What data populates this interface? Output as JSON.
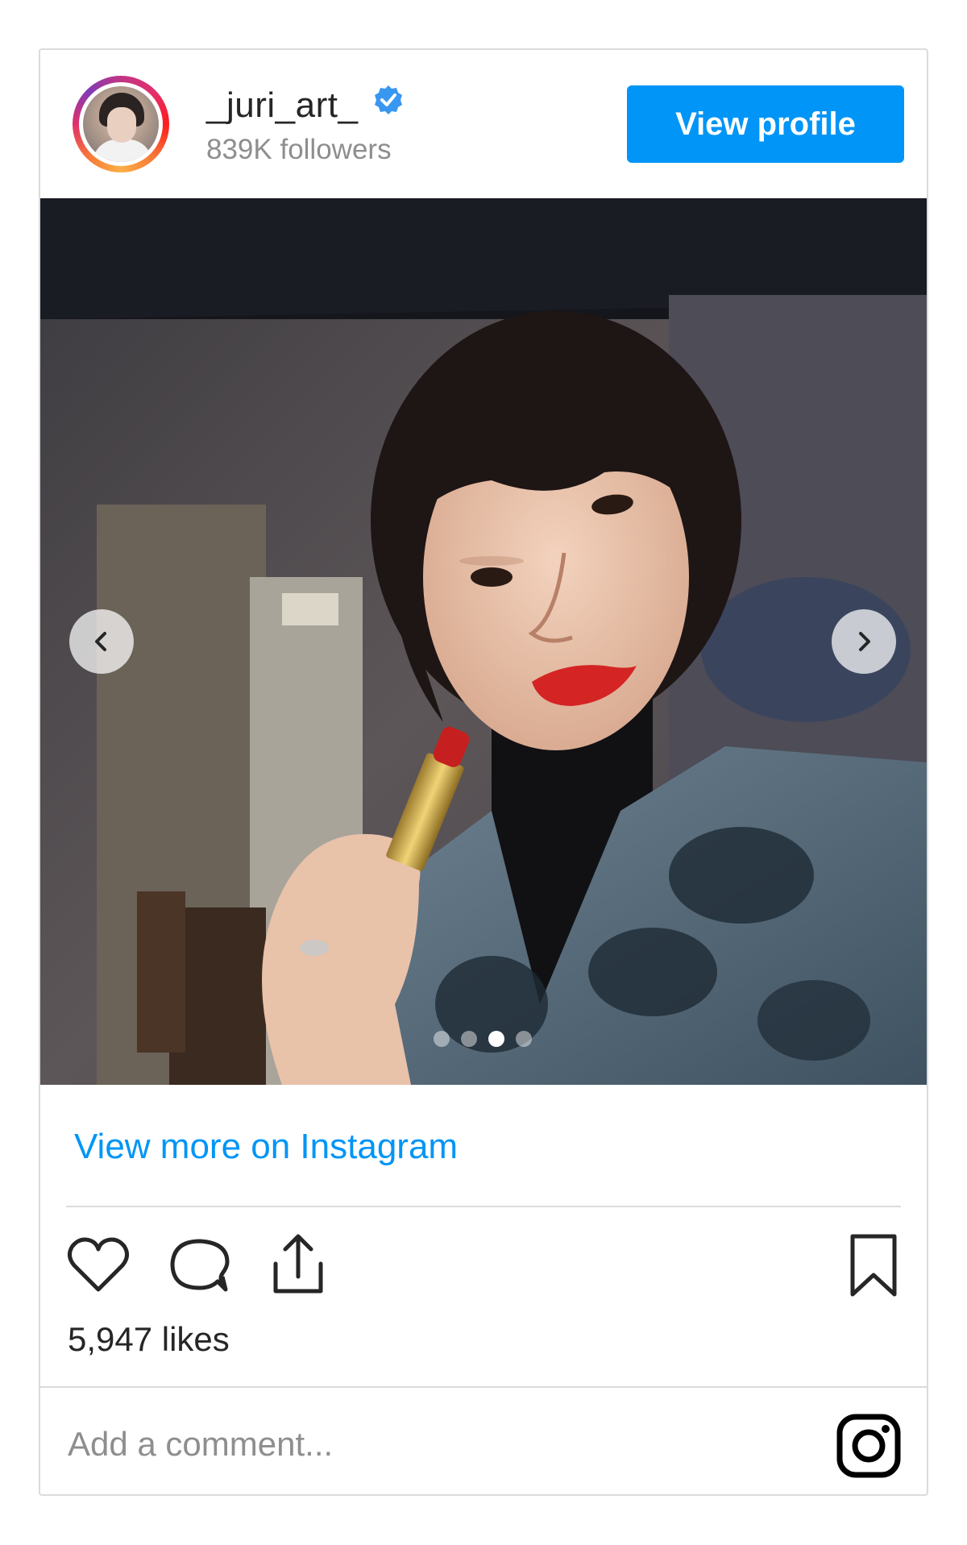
{
  "header": {
    "username": "_juri_art_",
    "followers": "839K followers",
    "view_profile_label": "View profile",
    "verified_color": "#3897f0"
  },
  "carousel": {
    "image_count": 4,
    "active_index": 2
  },
  "view_more_label": "View more on Instagram",
  "likes": "5,947 likes",
  "comment": {
    "placeholder": "Add a comment...",
    "value": ""
  },
  "colors": {
    "accent": "#0095f6",
    "border": "#dbdbdb",
    "text": "#262626",
    "muted": "#8e8e8e"
  },
  "icons": [
    "verified-icon",
    "chevron-left-icon",
    "chevron-right-icon",
    "heart-icon",
    "comment-icon",
    "share-icon",
    "bookmark-icon",
    "instagram-logo-icon"
  ]
}
